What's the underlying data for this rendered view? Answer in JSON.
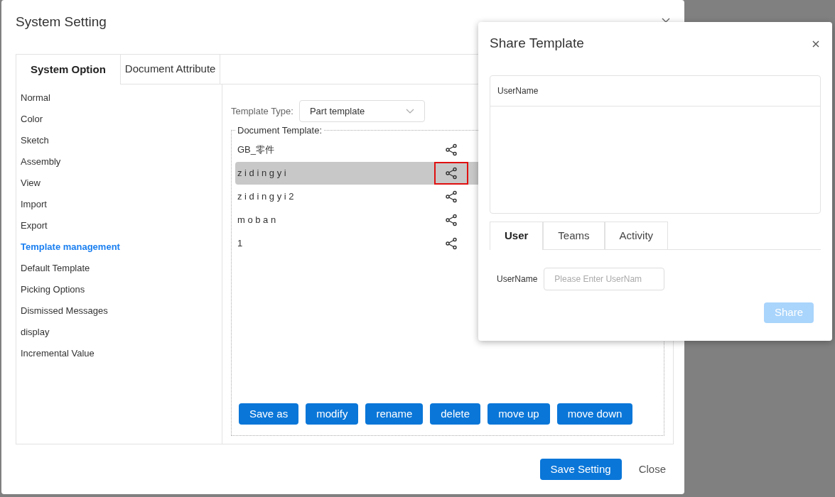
{
  "settings_dialog": {
    "title": "System Setting",
    "tabs": [
      {
        "label": "System Option",
        "selected": true
      },
      {
        "label": "Document Attribute",
        "selected": false
      }
    ],
    "sidebar": {
      "items": [
        {
          "label": "Normal",
          "selected": false
        },
        {
          "label": "Color",
          "selected": false
        },
        {
          "label": "Sketch",
          "selected": false
        },
        {
          "label": "Assembly",
          "selected": false
        },
        {
          "label": "View",
          "selected": false
        },
        {
          "label": "Import",
          "selected": false
        },
        {
          "label": "Export",
          "selected": false
        },
        {
          "label": "Template management",
          "selected": true
        },
        {
          "label": "Default Template",
          "selected": false
        },
        {
          "label": "Picking Options",
          "selected": false
        },
        {
          "label": "Dismissed Messages",
          "selected": false
        },
        {
          "label": "display",
          "selected": false
        },
        {
          "label": "Incremental Value",
          "selected": false
        }
      ]
    },
    "template_type": {
      "label": "Template Type:",
      "value": "Part template"
    },
    "document_template": {
      "legend": "Document Template:",
      "items": [
        {
          "name": "GB_零件",
          "selected": false,
          "highlighted": false
        },
        {
          "name": "z i d i n g y i",
          "selected": true,
          "highlighted": true
        },
        {
          "name": "z i d i n g y i 2",
          "selected": false,
          "highlighted": false
        },
        {
          "name": "m o b a n",
          "selected": false,
          "highlighted": false
        },
        {
          "name": "1",
          "selected": false,
          "highlighted": false
        }
      ],
      "buttons": [
        "Save as",
        "modify",
        "rename",
        "delete",
        "move up",
        "move down"
      ]
    },
    "footer": {
      "primary": "Save Setting",
      "secondary": "Close"
    }
  },
  "share_dialog": {
    "title": "Share Template",
    "table": {
      "columns": [
        "UserName"
      ]
    },
    "tabs": [
      {
        "label": "User",
        "selected": true
      },
      {
        "label": "Teams",
        "selected": false
      },
      {
        "label": "Activity",
        "selected": false
      }
    ],
    "field": {
      "label": "UserName",
      "placeholder": "Please Enter UserNam"
    },
    "share_button": {
      "label": "Share",
      "disabled": true
    }
  }
}
